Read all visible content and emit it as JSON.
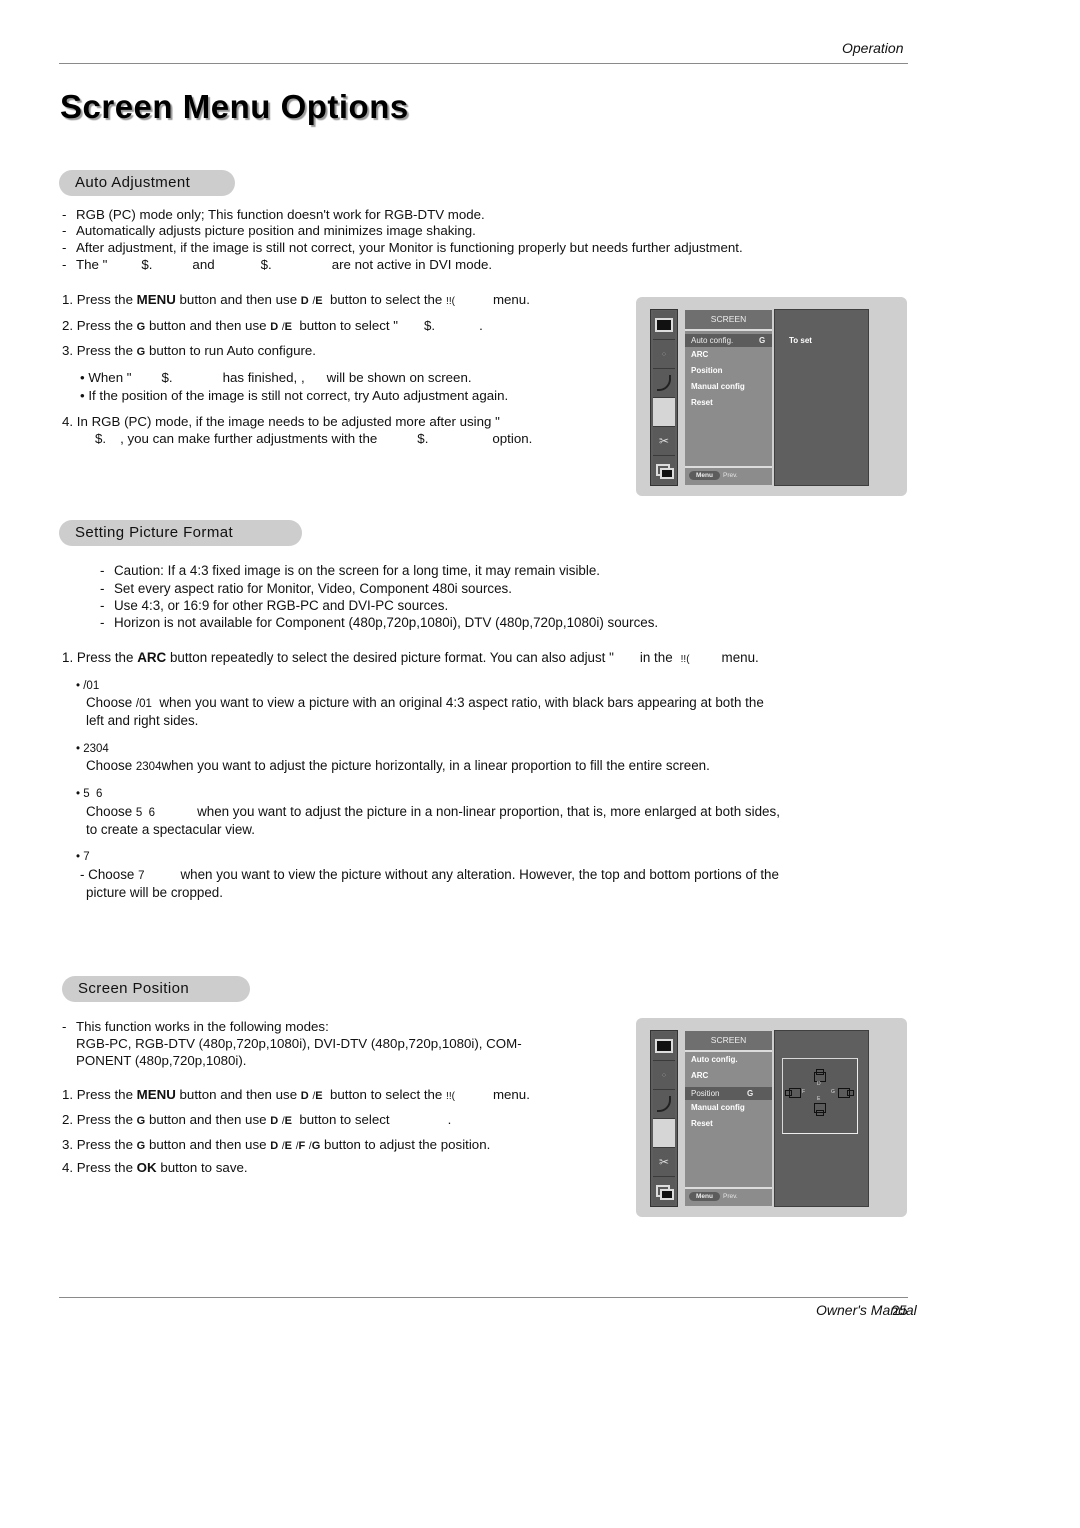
{
  "header": {
    "section": "Operation"
  },
  "title": "Screen Menu Options",
  "auto_adjustment": {
    "heading": "Auto Adjustment",
    "notes": [
      "RGB (PC) mode only; This function doesn't work for RGB-DTV mode.",
      "Automatically adjusts picture position and minimizes image shaking.",
      "After adjustment, if the image is still not correct, your Monitor is functioning properly but needs further adjustment.",
      {
        "a": "The \"",
        "b": "$.",
        "c": "and",
        "d": "$.",
        "e": "are not active in DVI mode."
      }
    ],
    "steps": {
      "s1": {
        "num": "1.",
        "a": "Press the",
        "bold": "MENU",
        "b": "button and then use",
        "k1": "D",
        "sl": "/",
        "k2": "E",
        "c": "button to select the",
        "d": "!!(",
        "e": "menu."
      },
      "s2": {
        "num": "2.",
        "a": "Press the",
        "k0": "G",
        "b": "button and then use",
        "k1": "D",
        "sl": "/",
        "k2": "E",
        "c": "button to select \"",
        "d": "$.",
        "e": "."
      },
      "s3": {
        "num": "3.",
        "a": "Press the",
        "k0": "G",
        "b": "button to run Auto configure."
      },
      "b1": {
        "a": "• When \"",
        "b": "$.",
        "c": "has finished,",
        "d": ",",
        "e": "will be shown on screen."
      },
      "b2": "• If the position of the image is still not correct, try Auto adjustment again.",
      "s4": {
        "num": "4.",
        "a": "In RGB (PC) mode, if the image needs to be adjusted more after using \"",
        "b": "$.",
        "c": ", you can make further adjustments with the",
        "d": "$.",
        "e": "option."
      }
    },
    "osd": {
      "title": "SCREEN",
      "items": [
        "Auto config.",
        "ARC",
        "Position",
        "Manual config",
        "Reset"
      ],
      "selected_glyph": "G",
      "right_text": "To set",
      "footer_menu": "Menu",
      "footer_prev": "Prev."
    }
  },
  "picture_format": {
    "heading": "Setting Picture Format",
    "notes": [
      "Caution: If a 4:3 fixed image is on the screen for a long time, it may remain visible.",
      "Set every aspect ratio for Monitor, Video, Component 480i sources.",
      "Use 4:3, or 16:9 for other RGB-PC and DVI-PC sources.",
      "Horizon is not available for Component (480p,720p,1080i), DTV (480p,720p,1080i) sources."
    ],
    "step1": {
      "a": "1. Press the",
      "bold": "ARC",
      "b": "button repeatedly to select the desired picture format. You can also adjust \"",
      "c": "in the",
      "d": "!!(",
      "e": "menu."
    },
    "options": [
      {
        "name": "/01",
        "desc_a": "Choose",
        "desc_name": "/01",
        "desc_b": "when you want to view a picture with an original 4:3 aspect ratio, with black bars appearing at both the",
        "desc_c": "left and right sides."
      },
      {
        "name": "2304",
        "desc_a": "Choose",
        "desc_name": "2304",
        "desc_b": "when you want to adjust the picture horizontally, in a linear proportion to fill the entire screen."
      },
      {
        "name": "5  6",
        "desc_a": "Choose",
        "desc_name": "5  6",
        "desc_b": "when you want to adjust the picture in a non-linear proportion, that is, more enlarged at both sides,",
        "desc_c": "to create a spectacular view."
      },
      {
        "name": "7",
        "desc_a": "- Choose",
        "desc_name": "7",
        "desc_b": "when you want to view the picture without any alteration. However, the top and bottom portions of the",
        "desc_c": "picture will be cropped."
      }
    ]
  },
  "screen_position": {
    "heading": "Screen Position",
    "note_a": "This function works in the following modes:",
    "note_b": "RGB-PC, RGB-DTV (480p,720p,1080i), DVI-DTV (480p,720p,1080i), COM-",
    "note_c": "PONENT (480p,720p,1080i).",
    "steps": {
      "s1": {
        "num": "1.",
        "a": "Press the",
        "bold": "MENU",
        "b": "button and then use",
        "k1": "D",
        "sl": "/",
        "k2": "E",
        "c": "button to select the",
        "d": "!!(",
        "e": "menu."
      },
      "s2": {
        "num": "2.",
        "a": "Press the",
        "k0": "G",
        "b": "button and then use",
        "k1": "D",
        "sl": "/",
        "k2": "E",
        "c": "button to select",
        "e": "."
      },
      "s3": {
        "num": "3.",
        "a": "Press the",
        "k0": "G",
        "b": "button and then use",
        "k1": "D",
        "sl1": "/",
        "k2": "E",
        "sl2": "/",
        "k3": "F",
        "sl3": "/",
        "k4": "G",
        "c": "button to adjust the position."
      },
      "s4": {
        "num": "4.",
        "a": "Press the",
        "bold": "OK",
        "b": "button to save."
      }
    },
    "osd": {
      "title": "SCREEN",
      "items": [
        "Auto config.",
        "ARC",
        "Position",
        "Manual config",
        "Reset"
      ],
      "selected_glyph": "G",
      "arrows": {
        "up": "D",
        "down": "E",
        "left": "F",
        "right": "G"
      },
      "footer_menu": "Menu",
      "footer_prev": "Prev."
    }
  },
  "footer": {
    "label": "Owner's Manual",
    "page": "25"
  }
}
